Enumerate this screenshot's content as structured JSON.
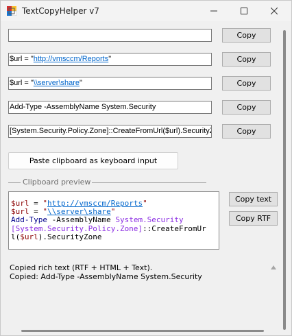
{
  "window": {
    "title": "TextCopyHelper v7",
    "minimize_glyph": "—",
    "maximize_glyph": "☐",
    "close_glyph": "✕"
  },
  "fields": [
    {
      "prefix": "",
      "link": "",
      "suffix": ""
    },
    {
      "prefix": "$url = \"",
      "link": "http://vmsccm/Reports",
      "suffix": "\""
    },
    {
      "prefix": "$url = \"",
      "link": "\\\\server\\share",
      "suffix": "\""
    },
    {
      "prefix": "Add-Type -AssemblyName System.Security",
      "link": "",
      "suffix": ""
    },
    {
      "prefix": "[System.Security.Policy.Zone]::CreateFromUrl($url).SecurityZone",
      "link": "",
      "suffix": ""
    }
  ],
  "copy_label": "Copy",
  "paste_button_label": "Paste clipboard as keyboard input",
  "preview": {
    "group_label": "Clipboard preview",
    "line1": {
      "var": "$url",
      "eq": " = ",
      "q1": "\"",
      "link": "http://vmsccm/Reports",
      "q2": "\""
    },
    "line2": {
      "var": "$url",
      "eq": " = ",
      "q1": "\"",
      "link": "\\\\server\\share",
      "q2": "\""
    },
    "line3": {
      "cmd": "Add-Type",
      "param": " -AssemblyName ",
      "type": "System.Security"
    },
    "line4": {
      "type": "[System.Security.Policy.Zone]",
      "rest": "::CreateFromUr"
    },
    "line5": {
      "open": "l(",
      "var": "$url",
      "rest": ").SecurityZone"
    },
    "copy_text_label": "Copy text",
    "copy_rtf_label": "Copy RTF"
  },
  "log": [
    "Copied rich text (RTF + HTML + Text).",
    "Copied: Add-Type -AssemblyName System.Security"
  ],
  "colors": {
    "variable": "#8b0000",
    "keyword": "#00008b",
    "type": "#8a2be2",
    "link": "#0066cc"
  }
}
